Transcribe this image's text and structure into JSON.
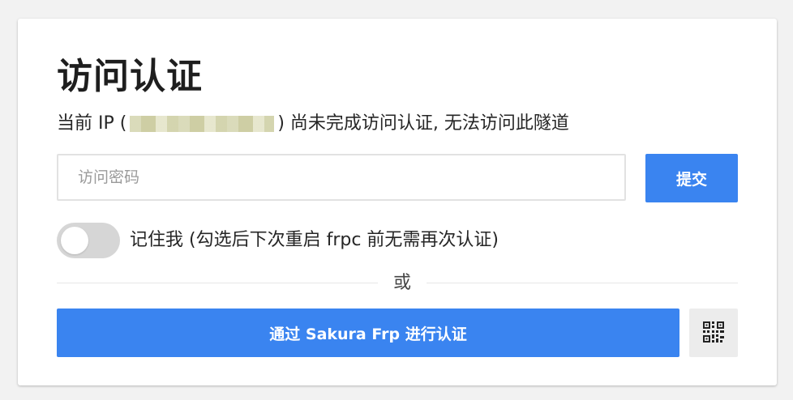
{
  "auth": {
    "title": "访问认证",
    "ip_prefix": "当前 IP (",
    "ip_suffix": ") 尚未完成访问认证, 无法访问此隧道",
    "password_placeholder": "访问密码",
    "password_value": "",
    "submit_label": "提交",
    "remember_label": "记住我 (勾选后下次重启 frpc 前无需再次认证)",
    "remember_checked": false,
    "divider_text": "或",
    "sakura_button_label": "通过 Sakura Frp 进行认证",
    "qr_icon": "qrcode-icon"
  },
  "colors": {
    "accent": "#3a84f0",
    "toggle_off": "#d6d6d6",
    "qr_button_bg": "#ececec"
  }
}
